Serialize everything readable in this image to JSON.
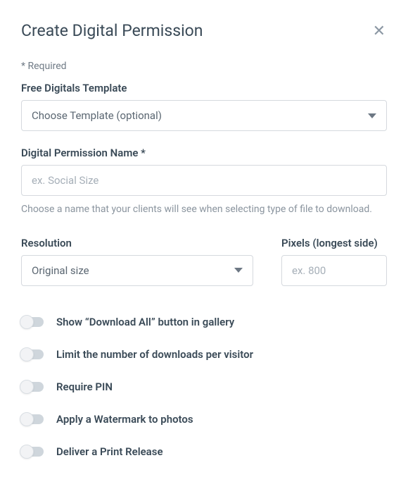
{
  "header": {
    "title": "Create Digital Permission",
    "required_note": "* Required"
  },
  "template": {
    "label": "Free Digitals Template",
    "selected": "Choose Template (optional)"
  },
  "name": {
    "label": "Digital Permission Name *",
    "placeholder": "ex. Social Size",
    "help": "Choose a name that your clients will see when selecting type of file to download."
  },
  "resolution": {
    "label": "Resolution",
    "selected": "Original size"
  },
  "pixels": {
    "label": "Pixels (longest side)",
    "placeholder": "ex. 800"
  },
  "toggles": [
    {
      "label": "Show “Download All” button in gallery"
    },
    {
      "label": "Limit the number of downloads per visitor"
    },
    {
      "label": "Require PIN"
    },
    {
      "label": "Apply a Watermark to photos"
    },
    {
      "label": "Deliver a Print Release"
    }
  ]
}
